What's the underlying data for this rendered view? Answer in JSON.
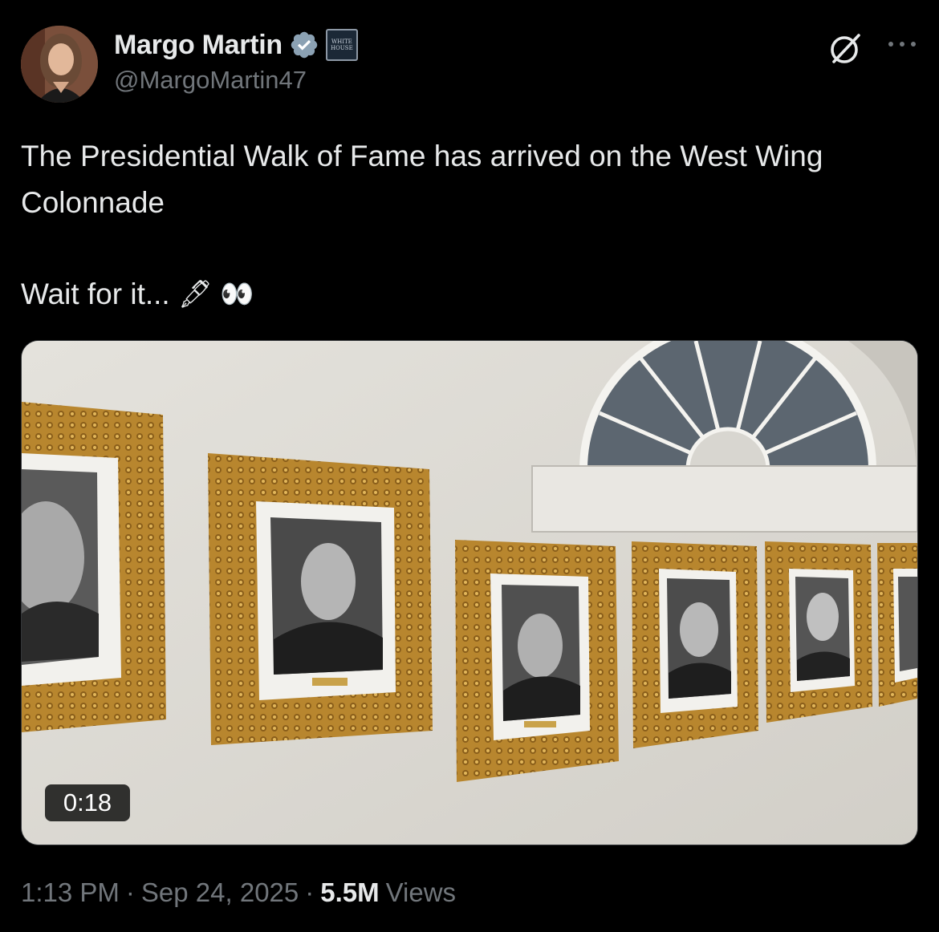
{
  "author": {
    "name": "Margo Martin",
    "handle": "@MargoMartin47",
    "affiliation_badge": "WHITE HOUSE",
    "avatar_icon": "avatar-photo",
    "verified_icon": "verified-badge-icon"
  },
  "actions": {
    "grok_icon": "grok-icon",
    "more_icon": "more-options-icon"
  },
  "tweet": {
    "line1": "The Presidential Walk of Fame has arrived on the West Wing Colonnade",
    "line2": "Wait for it...",
    "emoji": "🖋 👀"
  },
  "media": {
    "type": "video",
    "duration": "0:18"
  },
  "meta": {
    "time": "1:13 PM",
    "sep1": "·",
    "date": "Sep 24, 2025",
    "sep2": "·",
    "views_count": "5.5M",
    "views_label": "Views"
  },
  "colors": {
    "background": "#000000",
    "text_primary": "#e7e9ea",
    "text_secondary": "#71767b",
    "verified_blue": "#8ba1b3",
    "frame_gold": "#b8862e"
  }
}
